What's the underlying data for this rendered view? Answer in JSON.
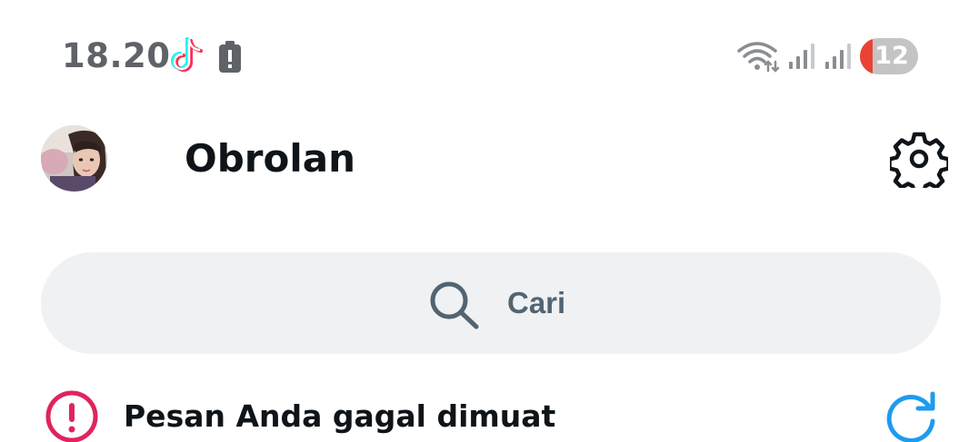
{
  "status_bar": {
    "time": "18.20",
    "battery_level": "12",
    "icons": [
      "tiktok-icon",
      "battery-alert-icon",
      "wifi-icon",
      "signal-icon",
      "signal-icon"
    ]
  },
  "header": {
    "title": "Obrolan",
    "avatar": "profile-avatar",
    "settings_icon": "gear-icon"
  },
  "search": {
    "placeholder": "Cari",
    "icon": "search-icon"
  },
  "error_banner": {
    "message": "Pesan Anda gagal dimuat",
    "icon": "error-icon",
    "action_icon": "refresh-icon"
  },
  "colors": {
    "accent": "#1d9bf0",
    "error": "#e0245e",
    "search_bg": "#eff1f3",
    "muted_text": "#536471"
  }
}
